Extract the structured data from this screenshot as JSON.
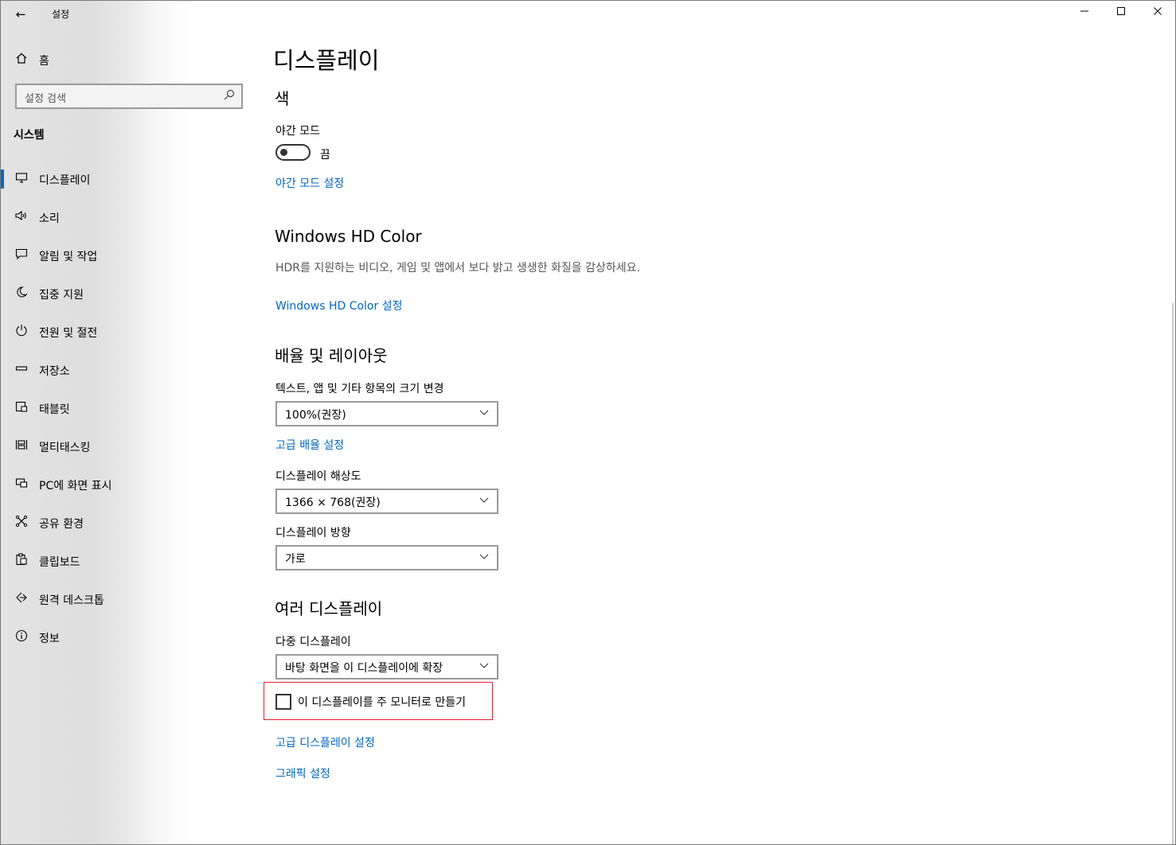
{
  "window": {
    "title": "설정",
    "controls": {
      "minimize": "—",
      "maximize": "☐",
      "close": "✕"
    }
  },
  "sidebar": {
    "back_icon": "back-arrow-icon",
    "home": {
      "icon": "home-icon",
      "label": "홈"
    },
    "search": {
      "placeholder": "설정 검색",
      "icon": "search-icon"
    },
    "section_title": "시스템",
    "items": [
      {
        "label": "디스플레이",
        "icon": "display-icon",
        "active": true
      },
      {
        "label": "소리",
        "icon": "speaker-icon"
      },
      {
        "label": "알림 및 작업",
        "icon": "message-icon"
      },
      {
        "label": "집중 지원",
        "icon": "moon-icon"
      },
      {
        "label": "전원 및 절전",
        "icon": "power-icon"
      },
      {
        "label": "저장소",
        "icon": "storage-icon"
      },
      {
        "label": "태블릿",
        "icon": "tablet-icon"
      },
      {
        "label": "멀티태스킹",
        "icon": "multitasking-icon"
      },
      {
        "label": "PC에 화면 표시",
        "icon": "project-icon"
      },
      {
        "label": "공유 환경",
        "icon": "share-icon"
      },
      {
        "label": "클립보드",
        "icon": "clipboard-icon"
      },
      {
        "label": "원격 데스크톱",
        "icon": "remote-desktop-icon"
      },
      {
        "label": "정보",
        "icon": "info-icon"
      }
    ]
  },
  "main": {
    "title": "디스플레이",
    "color": {
      "heading": "색",
      "night_light_label": "야간 모드",
      "night_light_state": "끔",
      "night_light_on": false,
      "night_light_link": "야간 모드 설정"
    },
    "hd_color": {
      "heading": "Windows HD Color",
      "description": "HDR를 지원하는 비디오, 게임 및 앱에서 보다 밝고 생생한 화질을 감상하세요.",
      "link": "Windows HD Color 설정"
    },
    "scale_layout": {
      "heading": "배율 및 레이아웃",
      "scale_label": "텍스트, 앱 및 기타 항목의 크기 변경",
      "scale_value": "100%(권장)",
      "advanced_scale_link": "고급 배율 설정",
      "resolution_label": "디스플레이 해상도",
      "resolution_value": "1366 × 768(권장)",
      "orientation_label": "디스플레이 방향",
      "orientation_value": "가로"
    },
    "multi_display": {
      "heading": "여러 디스플레이",
      "multi_label": "다중 디스플레이",
      "multi_value": "바탕 화면을 이 디스플레이에 확장",
      "main_display_checkbox": "이 디스플레이를 주 모니터로 만들기",
      "main_display_checked": false,
      "advanced_display_link": "고급 디스플레이 설정",
      "graphics_link": "그래픽 설정"
    }
  }
}
